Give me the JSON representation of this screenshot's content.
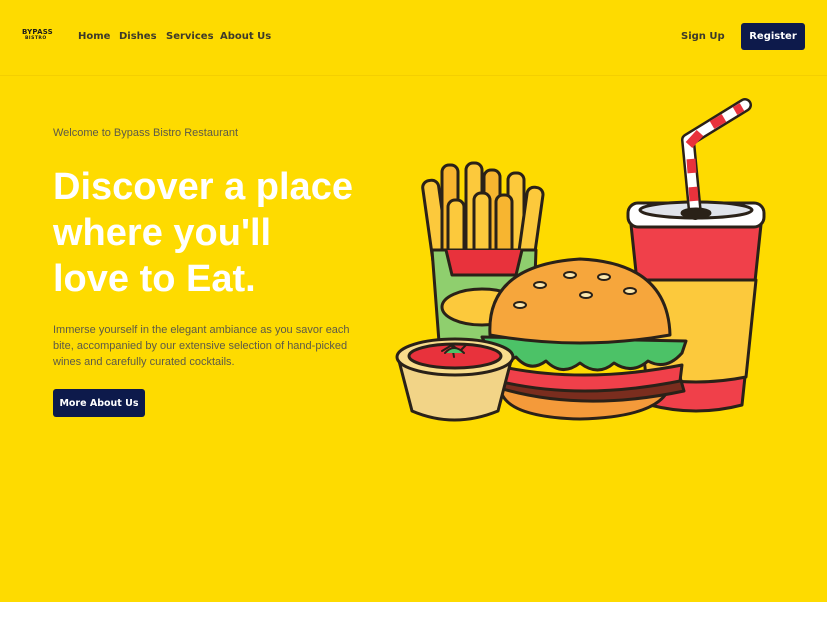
{
  "brand": {
    "line1": "BYPASS",
    "line2": "BISTRO"
  },
  "nav": {
    "items": [
      {
        "label": "Home"
      },
      {
        "label": "Dishes"
      },
      {
        "label": "Services"
      },
      {
        "label": "About Us"
      }
    ],
    "signup_label": "Sign Up",
    "register_label": "Register"
  },
  "hero": {
    "welcome": "Welcome to Bypass Bistro Restaurant",
    "headline": [
      "Discover a place",
      "where you'll",
      "love to Eat."
    ],
    "description": "Immerse yourself in the elegant ambiance as you savor each bite, accompanied by our extensive selection of hand-picked wines and carefully curated cocktails.",
    "cta_label": "More About Us",
    "illustration_icon": "fast-food-illustration"
  },
  "colors": {
    "hero_background": "#FEDB00",
    "button_background": "#0d1a4b",
    "headline_color": "#ffffff"
  }
}
